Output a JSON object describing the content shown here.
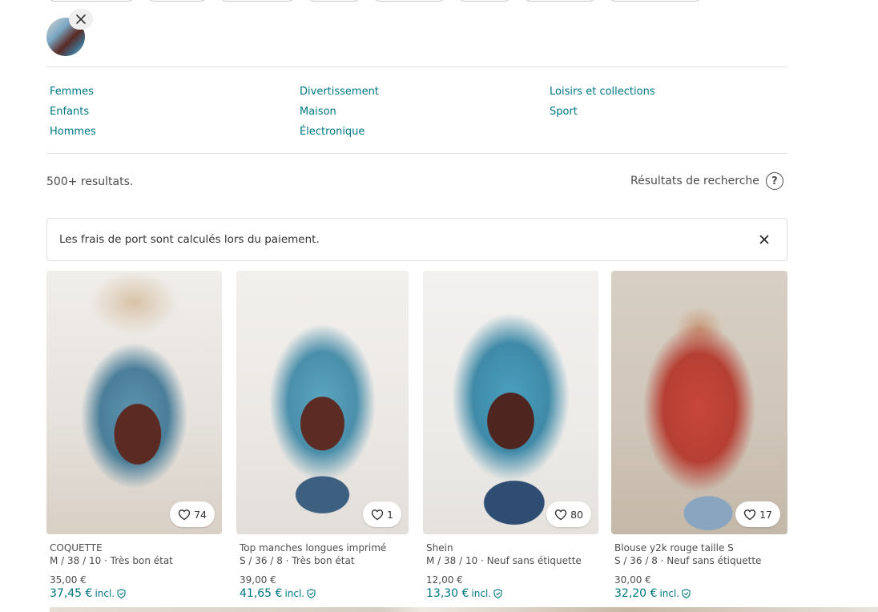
{
  "categories": {
    "col1": [
      "Femmes",
      "Enfants",
      "Hommes"
    ],
    "col2": [
      "Divertissement",
      "Maison",
      "Électronique"
    ],
    "col3": [
      "Loisirs et collections",
      "Sport"
    ]
  },
  "results": {
    "count_text": "500+ resultats.",
    "info_label": "Résultats de recherche",
    "help_symbol": "?"
  },
  "notice": {
    "text": "Les frais de port sont calculés lors du paiement."
  },
  "items": [
    {
      "title": "COQUETTE",
      "meta": "M / 38 / 10 · Très bon état",
      "price": "35,00 €",
      "total": "37,45 €",
      "incl": "incl.",
      "favorites": "74"
    },
    {
      "title": "Top manches longues imprimé",
      "meta": "S / 36 / 8 · Très bon état",
      "price": "39,00 €",
      "total": "41,65 €",
      "incl": "incl.",
      "favorites": "1"
    },
    {
      "title": "Shein",
      "meta": "M / 38 / 10 · Neuf sans étiquette",
      "price": "12,00 €",
      "total": "13,30 €",
      "incl": "incl.",
      "favorites": "80"
    },
    {
      "title": "Blouse y2k rouge taille S",
      "meta": "S / 36 / 8 · Neuf sans étiquette",
      "price": "30,00 €",
      "total": "32,20 €",
      "incl": "incl.",
      "favorites": "17"
    }
  ],
  "colors": {
    "accent": "#007782",
    "text_muted": "#4d4d4d",
    "divider": "#e1e1e1"
  },
  "icons": {
    "remove": "close-icon",
    "help": "help-circle-icon",
    "favorite": "heart-icon",
    "buyer_protection": "shield-check-icon"
  }
}
